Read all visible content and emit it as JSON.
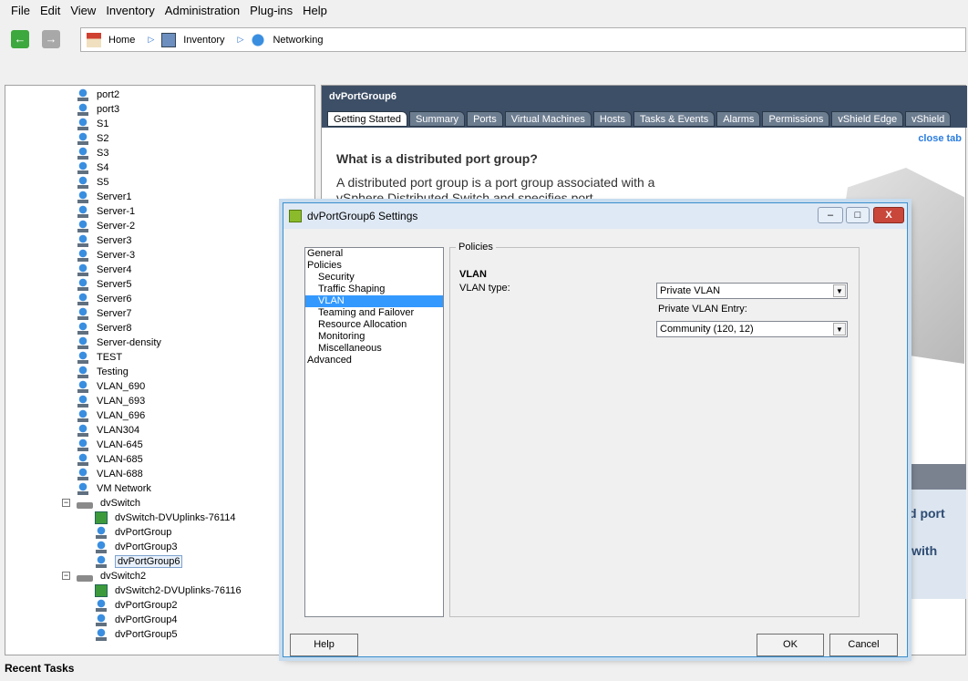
{
  "menu": [
    "File",
    "Edit",
    "View",
    "Inventory",
    "Administration",
    "Plug-ins",
    "Help"
  ],
  "breadcrumb": [
    "Home",
    "Inventory",
    "Networking"
  ],
  "tree": [
    {
      "label": "port2",
      "type": "pg",
      "level": 1
    },
    {
      "label": "port3",
      "type": "pg",
      "level": 1
    },
    {
      "label": "S1",
      "type": "pg",
      "level": 1
    },
    {
      "label": "S2",
      "type": "pg",
      "level": 1
    },
    {
      "label": "S3",
      "type": "pg",
      "level": 1
    },
    {
      "label": "S4",
      "type": "pg",
      "level": 1
    },
    {
      "label": "S5",
      "type": "pg",
      "level": 1
    },
    {
      "label": "Server1",
      "type": "pg",
      "level": 1
    },
    {
      "label": "Server-1",
      "type": "pg",
      "level": 1
    },
    {
      "label": "Server-2",
      "type": "pg",
      "level": 1
    },
    {
      "label": "Server3",
      "type": "pg",
      "level": 1
    },
    {
      "label": "Server-3",
      "type": "pg",
      "level": 1
    },
    {
      "label": "Server4",
      "type": "pg",
      "level": 1
    },
    {
      "label": "Server5",
      "type": "pg",
      "level": 1
    },
    {
      "label": "Server6",
      "type": "pg",
      "level": 1
    },
    {
      "label": "Server7",
      "type": "pg",
      "level": 1
    },
    {
      "label": "Server8",
      "type": "pg",
      "level": 1
    },
    {
      "label": "Server-density",
      "type": "pg",
      "level": 1
    },
    {
      "label": "TEST",
      "type": "pg",
      "level": 1
    },
    {
      "label": "Testing",
      "type": "pg",
      "level": 1
    },
    {
      "label": "VLAN_690",
      "type": "pg",
      "level": 1
    },
    {
      "label": "VLAN_693",
      "type": "pg",
      "level": 1
    },
    {
      "label": "VLAN_696",
      "type": "pg",
      "level": 1
    },
    {
      "label": "VLAN304",
      "type": "pg",
      "level": 1
    },
    {
      "label": "VLAN-645",
      "type": "pg",
      "level": 1
    },
    {
      "label": "VLAN-685",
      "type": "pg",
      "level": 1
    },
    {
      "label": "VLAN-688",
      "type": "pg",
      "level": 1
    },
    {
      "label": "VM Network",
      "type": "pg",
      "level": 1
    },
    {
      "label": "dvSwitch",
      "type": "sw",
      "level": 1
    },
    {
      "label": "dvSwitch-DVUplinks-76114",
      "type": "up",
      "level": 2
    },
    {
      "label": "dvPortGroup",
      "type": "pg",
      "level": 2
    },
    {
      "label": "dvPortGroup3",
      "type": "pg",
      "level": 2
    },
    {
      "label": "dvPortGroup6",
      "type": "pg",
      "level": 2,
      "selected": true
    },
    {
      "label": "dvSwitch2",
      "type": "sw",
      "level": 1
    },
    {
      "label": "dvSwitch2-DVUplinks-76116",
      "type": "up",
      "level": 2
    },
    {
      "label": "dvPortGroup2",
      "type": "pg",
      "level": 2
    },
    {
      "label": "dvPortGroup4",
      "type": "pg",
      "level": 2
    },
    {
      "label": "dvPortGroup5",
      "type": "pg",
      "level": 2
    }
  ],
  "right": {
    "title": "dvPortGroup6",
    "tabs": [
      "Getting Started",
      "Summary",
      "Ports",
      "Virtual Machines",
      "Hosts",
      "Tasks & Events",
      "Alarms",
      "Permissions",
      "vShield Edge",
      "vShield"
    ],
    "close_tab": "close tab",
    "heading": "What is a distributed port group?",
    "body": "A distributed port group is a port group associated with a vSphere Distributed Switch and specifies port",
    "frag1": "d port",
    "frag2": "rk with"
  },
  "dialog": {
    "title": "dvPortGroup6 Settings",
    "nav": [
      {
        "label": "General",
        "sub": false
      },
      {
        "label": "Policies",
        "sub": false
      },
      {
        "label": "Security",
        "sub": true
      },
      {
        "label": "Traffic Shaping",
        "sub": true
      },
      {
        "label": "VLAN",
        "sub": true,
        "selected": true
      },
      {
        "label": "Teaming and Failover",
        "sub": true
      },
      {
        "label": "Resource Allocation",
        "sub": true
      },
      {
        "label": "Monitoring",
        "sub": true
      },
      {
        "label": "Miscellaneous",
        "sub": true
      },
      {
        "label": "Advanced",
        "sub": false
      }
    ],
    "group": "Policies",
    "section": "VLAN",
    "vlan_type_label": "VLAN type:",
    "vlan_type_value": "Private VLAN",
    "pvlan_label": "Private VLAN Entry:",
    "pvlan_value": "Community (120, 12)",
    "help": "Help",
    "ok": "OK",
    "cancel": "Cancel"
  },
  "status": {
    "recent_tasks": "Recent Tasks"
  }
}
